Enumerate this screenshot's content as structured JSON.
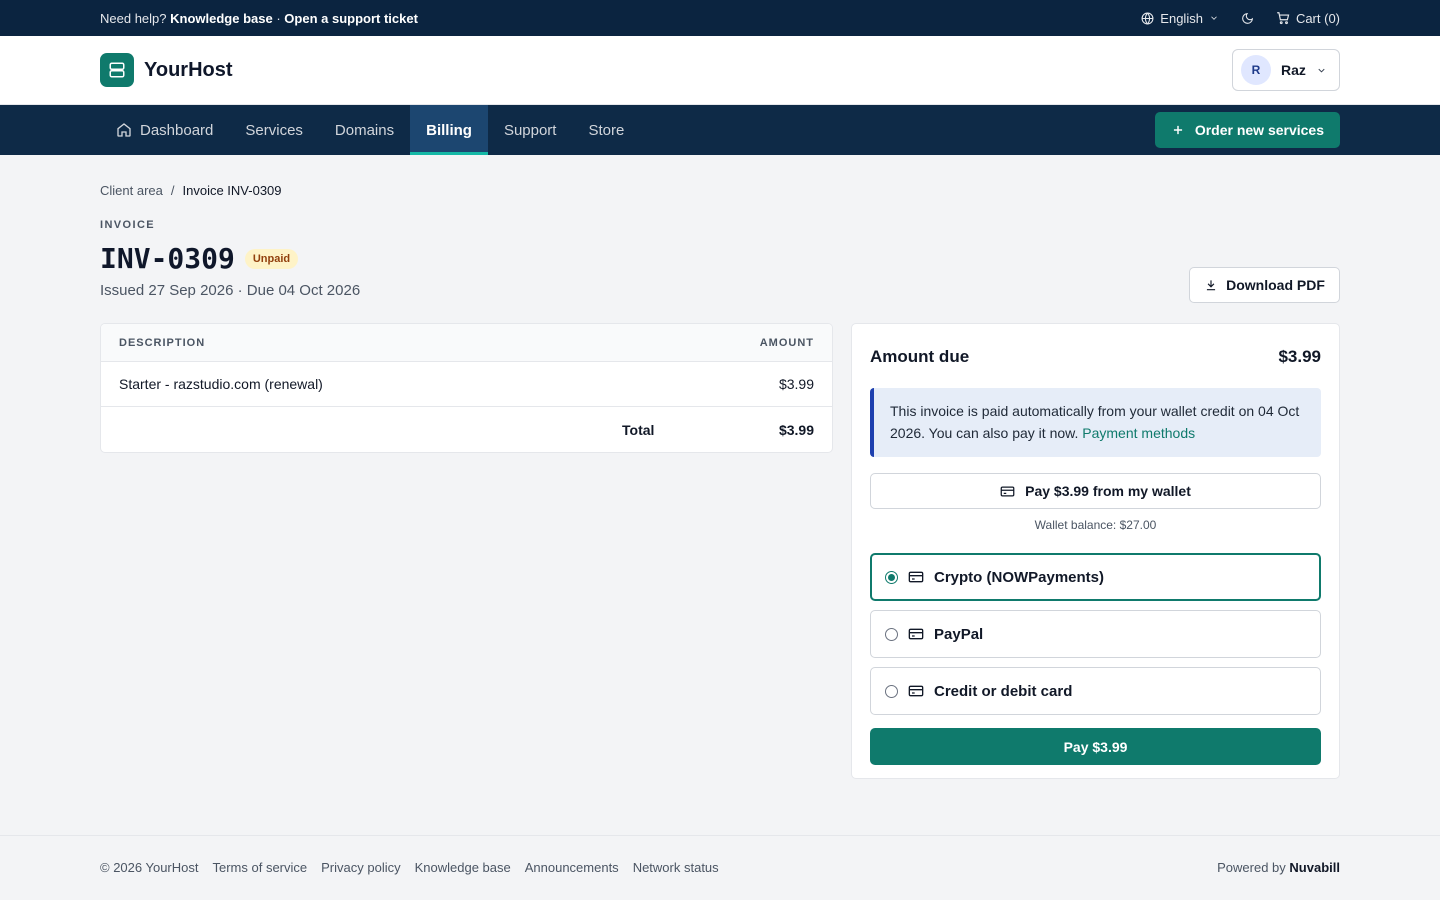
{
  "topbar": {
    "help_prefix": "Need help?",
    "kb_link": "Knowledge base",
    "sep": "·",
    "ticket_link": "Open a support ticket",
    "language": "English",
    "cart": "Cart (0)"
  },
  "header": {
    "brand": "YourHost",
    "user_initial": "R",
    "user_name": "Raz"
  },
  "nav": {
    "items": [
      {
        "label": "Dashboard"
      },
      {
        "label": "Services"
      },
      {
        "label": "Domains"
      },
      {
        "label": "Billing"
      },
      {
        "label": "Support"
      },
      {
        "label": "Store"
      }
    ],
    "active": "Billing",
    "order_button": "Order new services"
  },
  "breadcrumb": {
    "root": "Client area",
    "sep": "/",
    "current": "Invoice INV-0309"
  },
  "invoice": {
    "eyebrow": "INVOICE",
    "number": "INV-0309",
    "status": "Unpaid",
    "dates": "Issued 27 Sep 2026 · Due 04 Oct 2026",
    "download_button": "Download PDF",
    "columns": {
      "description": "DESCRIPTION",
      "amount": "AMOUNT"
    },
    "lines": [
      {
        "description": "Starter - razstudio.com (renewal)",
        "amount": "$3.99"
      }
    ],
    "total_label": "Total",
    "total_value": "$3.99"
  },
  "payment": {
    "amount_due_label": "Amount due",
    "amount_due_value": "$3.99",
    "info_text": "This invoice is paid automatically from your wallet credit on 04 Oct 2026. You can also pay it now.",
    "info_link": "Payment methods",
    "wallet_button": "Pay $3.99 from my wallet",
    "wallet_balance": "Wallet balance: $27.00",
    "methods": [
      {
        "label": "Crypto (NOWPayments)",
        "selected": true
      },
      {
        "label": "PayPal",
        "selected": false
      },
      {
        "label": "Credit or debit card",
        "selected": false
      }
    ],
    "pay_button": "Pay $3.99"
  },
  "footer": {
    "copyright": "© 2026 YourHost",
    "links": [
      "Terms of service",
      "Privacy policy",
      "Knowledge base",
      "Announcements",
      "Network status"
    ],
    "powered_prefix": "Powered by",
    "powered_brand": "Nuvabill"
  },
  "colors": {
    "brand_teal": "#0f7a6c",
    "topbar_navy": "#0b2440",
    "nav_navy": "#0e2a47",
    "unpaid_badge_bg": "#fef3c7"
  }
}
